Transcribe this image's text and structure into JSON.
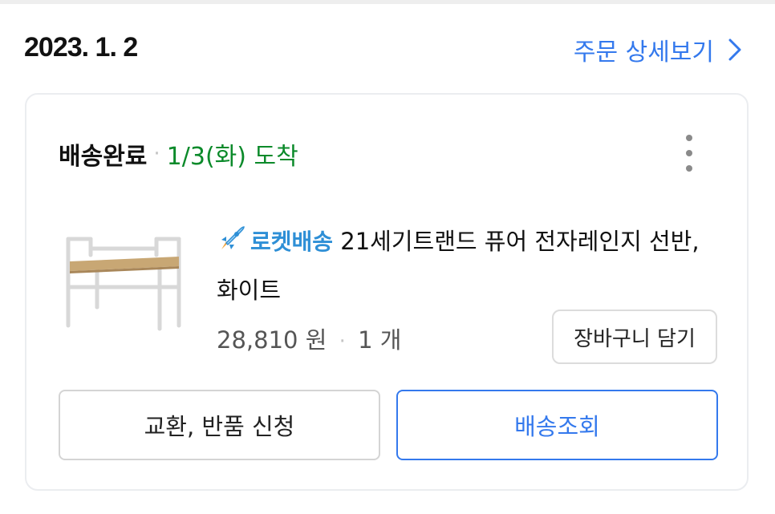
{
  "order": {
    "date": "2023. 1. 2",
    "detail_link_label": "주문 상세보기"
  },
  "shipment": {
    "status_label": "배송완료",
    "separator": "·",
    "arrival_text": "1/3(화) 도착"
  },
  "product": {
    "badge_label": "로켓배송",
    "name": "21세기트랜드 퓨어 전자레인지 선반, 화이트",
    "price": "28,810 원",
    "quantity": "1 개",
    "image_icon": "shelf-product-image"
  },
  "actions": {
    "add_to_cart_label": "장바구니 담기",
    "exchange_return_label": "교환, 반품 신청",
    "track_delivery_label": "배송조회"
  },
  "colors": {
    "accent_blue": "#3479ed",
    "arrival_green": "#0b8a2a",
    "rocket_blue": "#2e8fd6"
  }
}
